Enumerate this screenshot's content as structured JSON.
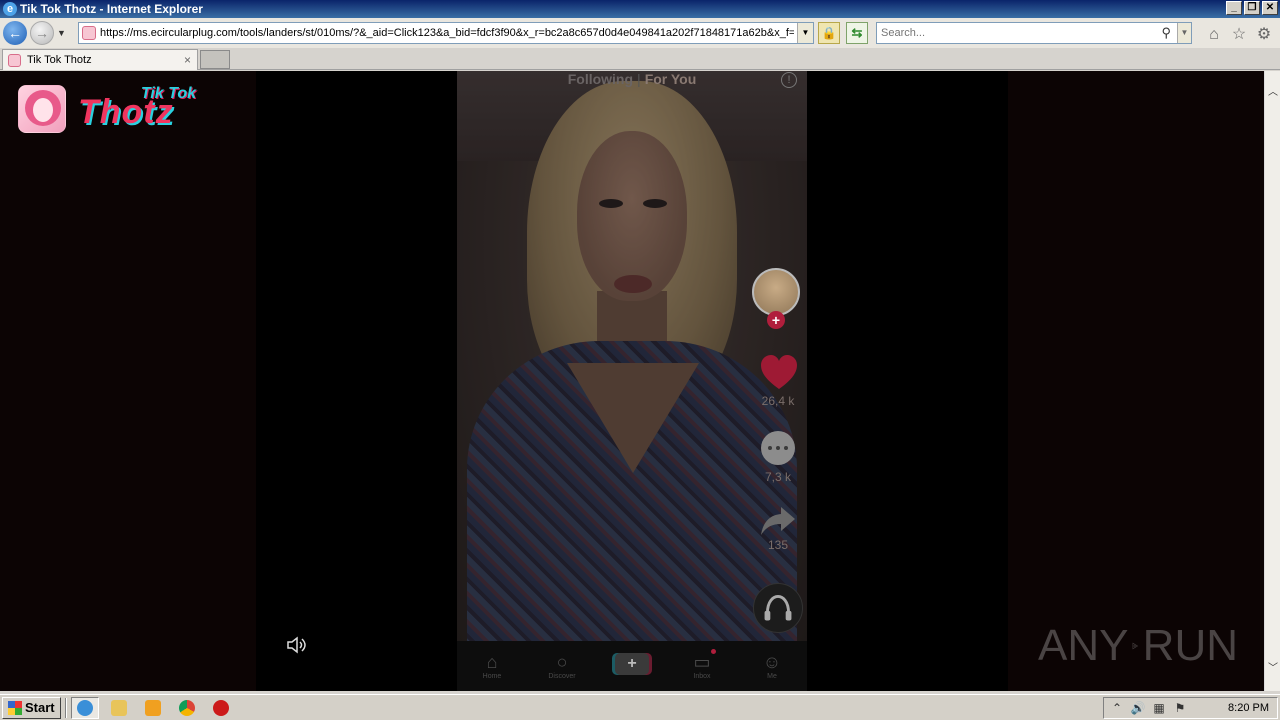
{
  "window": {
    "title": "Tik Tok Thotz - Internet Explorer",
    "buttons": {
      "minimize": "_",
      "restore": "❐",
      "close": "✕"
    }
  },
  "addressbar": {
    "url": "https://ms.ecircularplug.com/tools/landers/st/010ms/?&_aid=Click123&a_bid=fdcf3f90&x_r=bc2a8c657d0d4e049841a202f71848171a62b&x_f=",
    "search_placeholder": "Search..."
  },
  "tabs": [
    {
      "label": "Tik Tok Thotz",
      "close": "×"
    }
  ],
  "site": {
    "logo_small": "Tik Tok",
    "logo_big": "Thotz"
  },
  "feed": {
    "following": "Following",
    "separator": "|",
    "for_you": "For You",
    "info": "!",
    "follow_plus": "+",
    "likes": "26,4 k",
    "comments": "7,3 k",
    "shares": "135"
  },
  "bottom_nav": {
    "home": "Home",
    "discover": "Discover",
    "create": "+",
    "inbox": "Inbox",
    "me": "Me"
  },
  "watermark": {
    "left": "ANY",
    "right": "RUN"
  },
  "taskbar": {
    "start": "Start",
    "clock": "8:20 PM"
  },
  "icons": {
    "back": "back-arrow-icon",
    "forward": "forward-arrow-icon",
    "lock": "lock-icon",
    "refresh": "refresh-icon",
    "search": "search-icon",
    "home": "home-icon",
    "favorites": "star-icon",
    "tools": "gear-icon"
  },
  "colors": {
    "accent_pink": "#f0355f",
    "accent_cyan": "#2ad1e0",
    "like_red": "#b01e3c"
  }
}
